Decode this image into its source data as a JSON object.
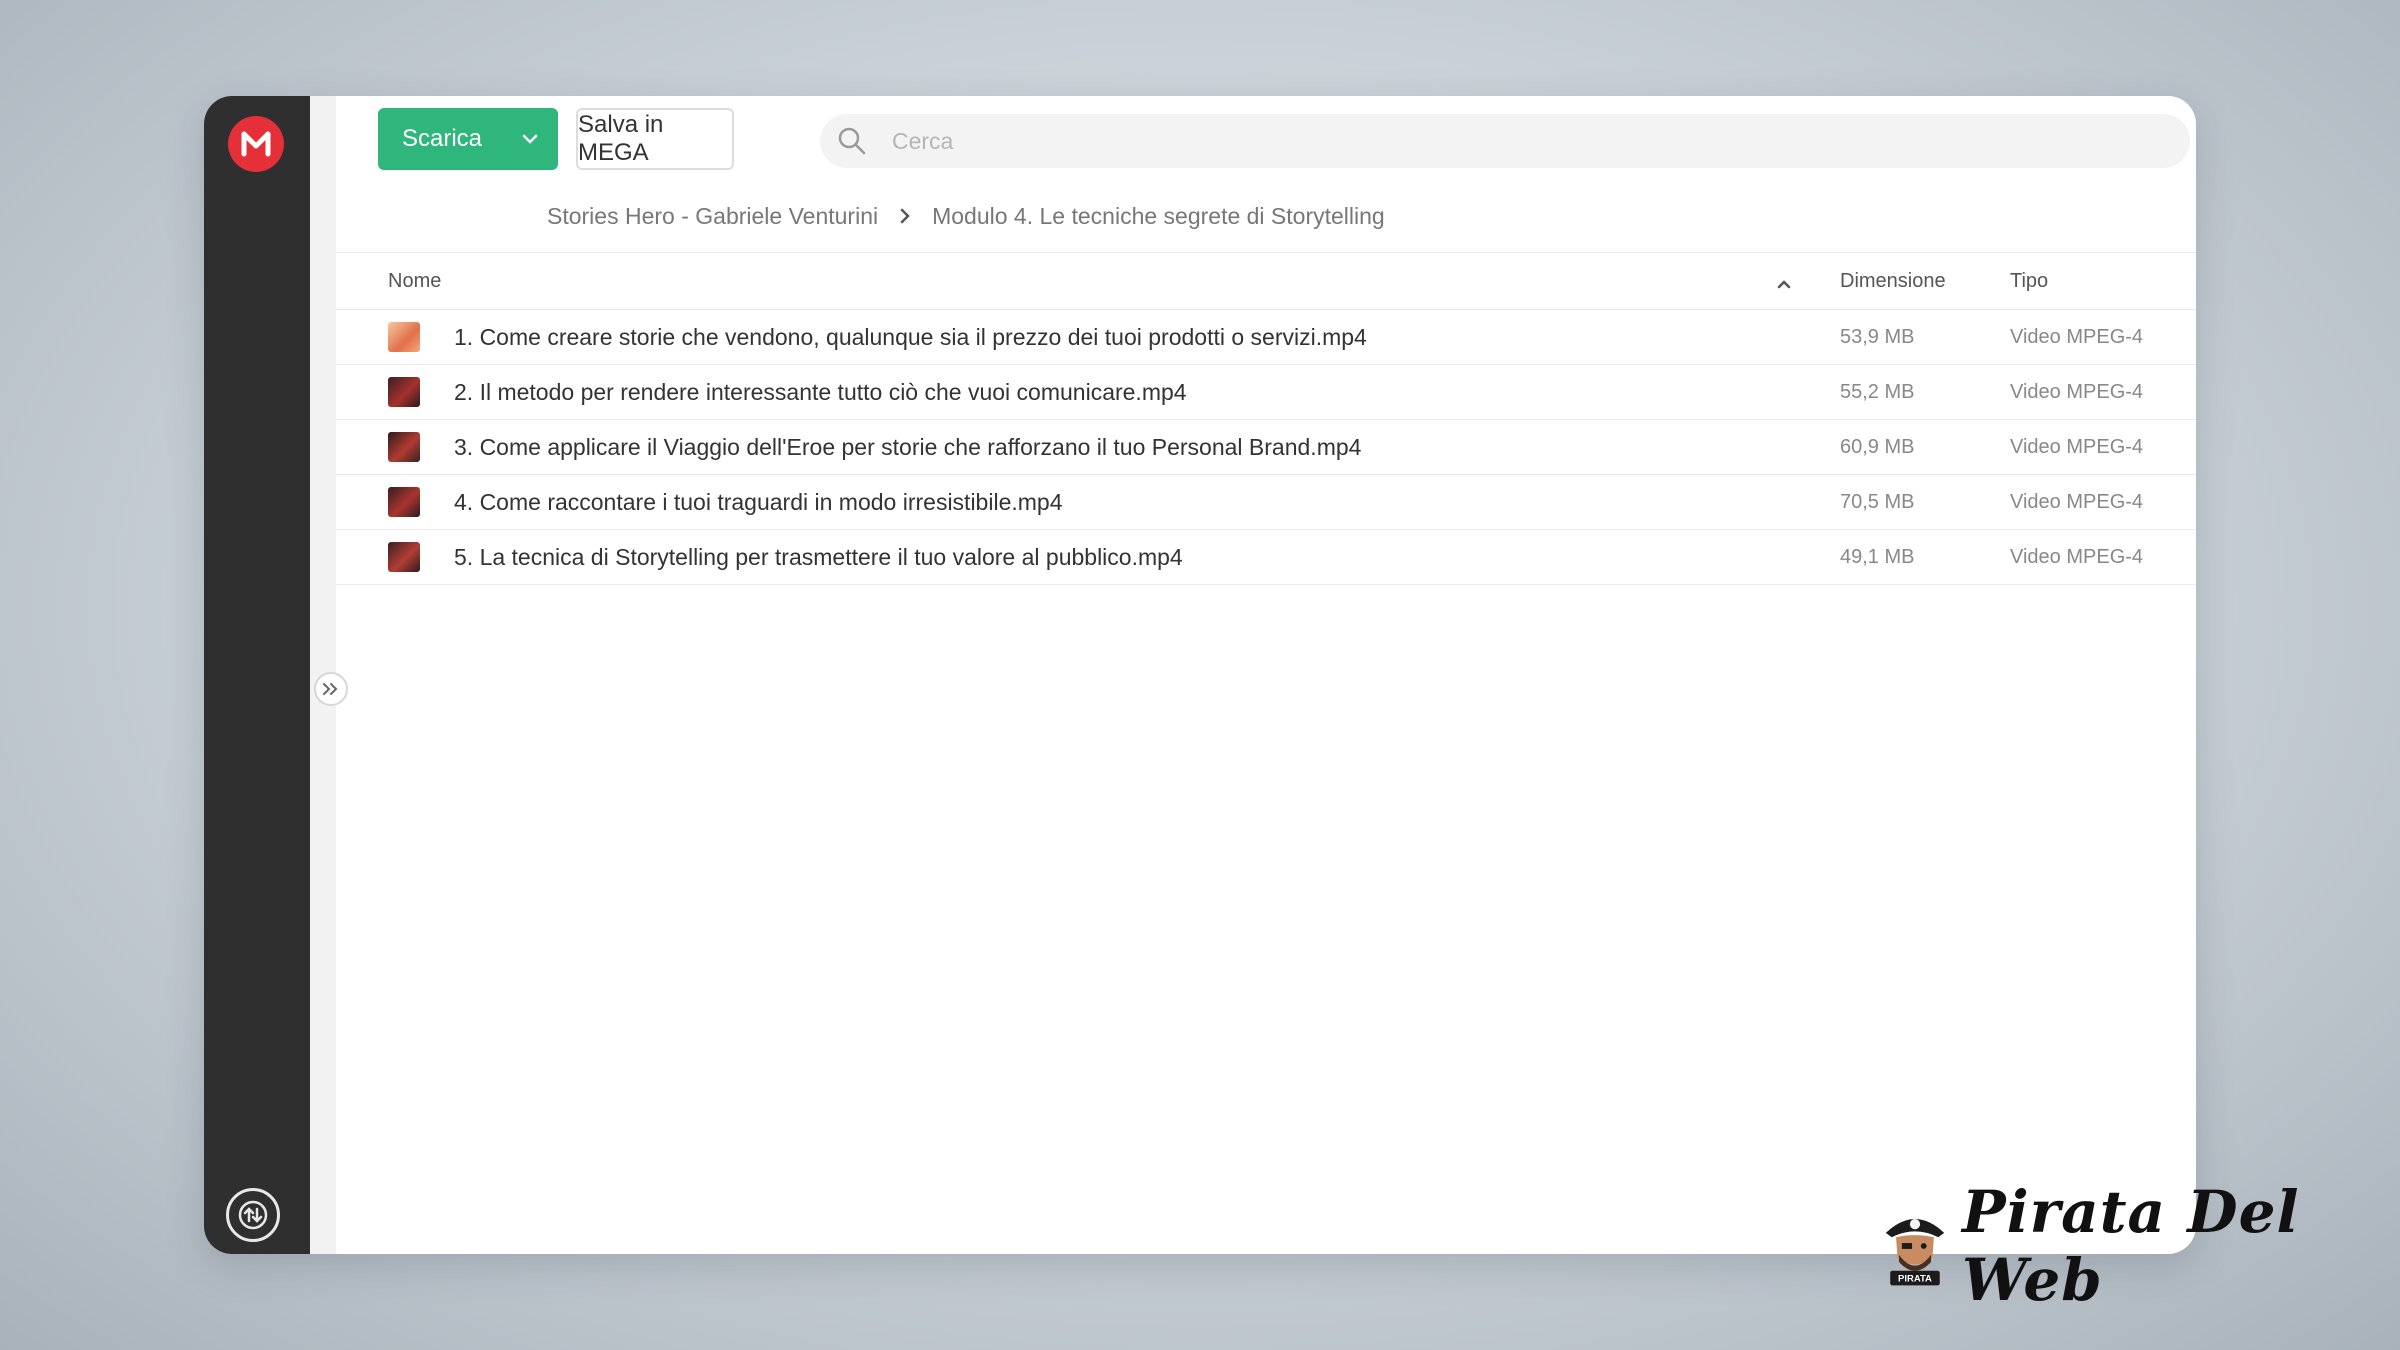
{
  "toolbar": {
    "download_label": "Scarica",
    "save_label": "Salva in MEGA",
    "search_placeholder": "Cerca"
  },
  "breadcrumb": {
    "parent": "Stories Hero - Gabriele Venturini",
    "current": "Modulo 4. Le tecniche segrete di Storytelling"
  },
  "table": {
    "headers": {
      "name": "Nome",
      "size": "Dimensione",
      "type": "Tipo"
    },
    "rows": [
      {
        "name": "1. Come creare storie che vendono, qualunque sia il prezzo dei tuoi prodotti o servizi.mp4",
        "size": "53,9 MB",
        "type": "Video MPEG-4"
      },
      {
        "name": "2. Il metodo per rendere interessante tutto ciò che vuoi comunicare.mp4",
        "size": "55,2 MB",
        "type": "Video MPEG-4"
      },
      {
        "name": "3. Come applicare il Viaggio dell'Eroe per storie che rafforzano il tuo Personal Brand.mp4",
        "size": "60,9 MB",
        "type": "Video MPEG-4"
      },
      {
        "name": "4. Come raccontare i tuoi traguardi in modo irresistibile.mp4",
        "size": "70,5 MB",
        "type": "Video MPEG-4"
      },
      {
        "name": "5. La tecnica di Storytelling per trasmettere il tuo valore al pubblico.mp4",
        "size": "49,1 MB",
        "type": "Video MPEG-4"
      }
    ]
  },
  "watermark": {
    "brand": "Pirata Del Web",
    "badge": "PIRATA"
  },
  "colors": {
    "accent_green": "#2fb67c",
    "mega_red": "#e5303a",
    "sidebar": "#2f2f2f"
  },
  "icons": [
    "mega-logo-icon",
    "transfer-icon",
    "expand-icon",
    "chevron-down-icon",
    "search-icon",
    "chevron-right-icon",
    "sort-up-icon",
    "video-thumbnail"
  ]
}
